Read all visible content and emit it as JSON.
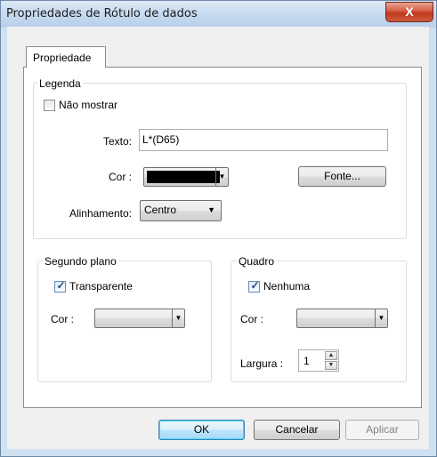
{
  "window": {
    "title": "Propriedades de Rótulo de dados",
    "close_glyph": "X"
  },
  "tab": {
    "label": "Propriedade"
  },
  "legenda": {
    "group_label": "Legenda",
    "nao_mostrar_label": "Não mostrar",
    "nao_mostrar_checked": false,
    "texto_label": "Texto:",
    "texto_value": "L*(D65)",
    "cor_label": "Cor :",
    "cor_value": "#000000",
    "fonte_button": "Fonte...",
    "alinhamento_label": "Alinhamento:",
    "alinhamento_value": "Centro"
  },
  "segundo_plano": {
    "group_label": "Segundo plano",
    "transparente_label": "Transparente",
    "transparente_checked": true,
    "cor_label": "Cor :"
  },
  "quadro": {
    "group_label": "Quadro",
    "nenhuma_label": "Nenhuma",
    "nenhuma_checked": true,
    "cor_label": "Cor :",
    "largura_label": "Largura :",
    "largura_value": "1"
  },
  "buttons": {
    "ok": "OK",
    "cancelar": "Cancelar",
    "aplicar": "Aplicar"
  },
  "icons": {
    "dropdown": "chevron-down-icon",
    "spin_up": "arrow-up-icon",
    "spin_down": "arrow-down-icon",
    "check": "checkmark-icon"
  }
}
